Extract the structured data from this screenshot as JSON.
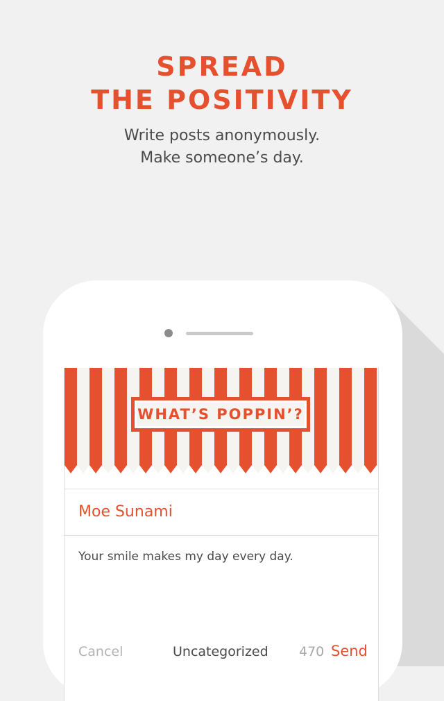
{
  "headline": {
    "line1": "SPREAD",
    "line2": "THE POSITIVITY"
  },
  "subhead": {
    "line1": "Write posts anonymously.",
    "line2": "Make someone’s day."
  },
  "app": {
    "banner_title": "WHAT’S POPPIN’?",
    "recipient_name": "Moe Sunami",
    "message": "Your smile makes my day every day.",
    "footer": {
      "cancel_label": "Cancel",
      "category_label": "Uncategorized",
      "char_count": "470",
      "send_label": "Send"
    }
  },
  "colors": {
    "accent": "#e5502f",
    "background": "#f1f1f1",
    "stripe_light": "#f5f4f1"
  },
  "icons": {
    "camera": "camera-dot-icon",
    "speaker": "speaker-grille-icon"
  }
}
